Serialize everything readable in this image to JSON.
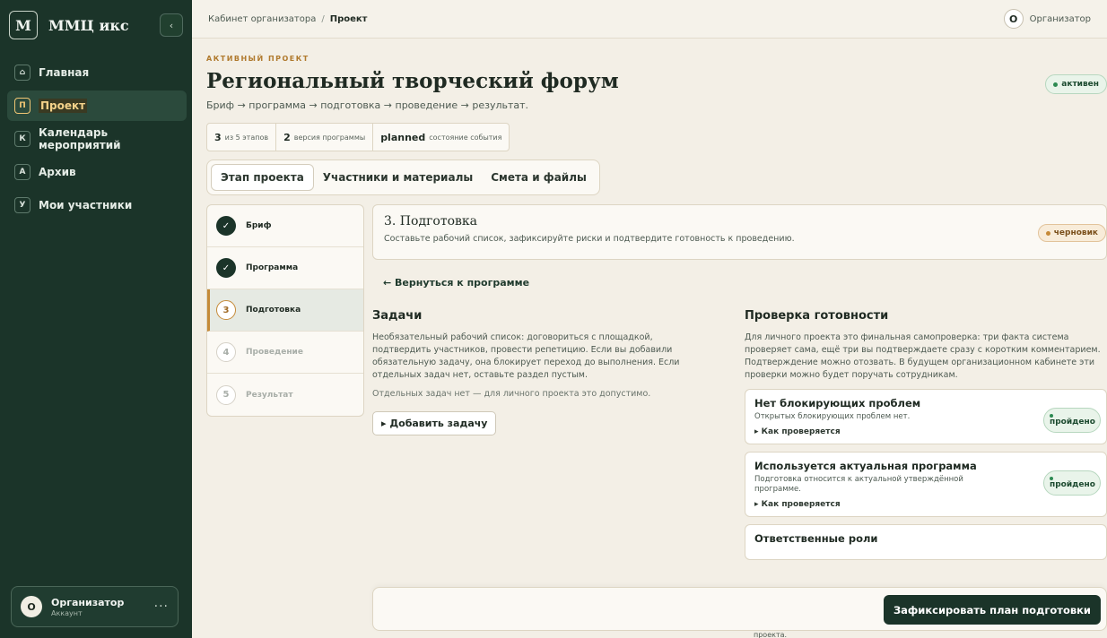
{
  "sidebar": {
    "logo_letter": "М",
    "app_name": "ММЦ икс",
    "collapse_icon": "‹",
    "items": [
      {
        "badge": "⌂",
        "label": "Главная"
      },
      {
        "badge": "П",
        "label": "Проект"
      },
      {
        "badge": "К",
        "label": "Календарь мероприятий"
      },
      {
        "badge": "А",
        "label": "Архив"
      },
      {
        "badge": "У",
        "label": "Мои участники"
      }
    ],
    "account": {
      "initial": "О",
      "name": "Организатор",
      "role": "Аккаунт",
      "more": "···"
    }
  },
  "topbar": {
    "crumb_root": "Кабинет организатора",
    "crumb_sep": "/",
    "crumb_current": "Проект",
    "user_initial": "О",
    "user_name": "Организатор"
  },
  "project": {
    "eyebrow": "АКТИВНЫЙ ПРОЕКТ",
    "title": "Региональный творческий форум",
    "subtitle": "Бриф → программа → подготовка → проведение → результат.",
    "status": "активен",
    "stats": [
      {
        "value": "3",
        "label": "из 5 этапов"
      },
      {
        "value": "2",
        "label": "версия программы"
      },
      {
        "value": "planned",
        "label": "состояние события"
      }
    ],
    "tabs": [
      "Этап проекта",
      "Участники и материалы",
      "Смета и файлы"
    ]
  },
  "steps": [
    {
      "marker": "✓",
      "label": "Бриф"
    },
    {
      "marker": "✓",
      "label": "Программа"
    },
    {
      "marker": "3",
      "label": "Подготовка"
    },
    {
      "marker": "4",
      "label": "Проведение"
    },
    {
      "marker": "5",
      "label": "Результат"
    }
  ],
  "stage": {
    "title": "3. Подготовка",
    "desc": "Составьте рабочий список, зафиксируйте риски и подтвердите готовность к проведению.",
    "status": "черновик",
    "back": "← Вернуться к программе"
  },
  "tasks": {
    "title": "Задачи",
    "desc": "Необязательный рабочий список: договориться с площадкой, подтвердить участников, провести репетицию. Если вы добавили обязательную задачу, она блокирует переход до выполнения. Если отдельных задач нет, оставьте раздел пустым.",
    "empty": "Отдельных задач нет — для личного проекта это допустимо.",
    "add_button": "▸ Добавить задачу"
  },
  "readiness": {
    "title": "Проверка готовности",
    "desc": "Для личного проекта это финальная самопроверка: три факта система проверяет сама, ещё три вы подтверждаете сразу с коротким комментарием. Подтверждение можно отозвать. В будущем организационном кабинете эти проверки можно будет поручать сотрудникам.",
    "checks": [
      {
        "title": "Нет блокирующих проблем",
        "desc": "Открытых блокирующих проблем нет.",
        "how": "▸ Как проверяется",
        "status": "пройдено"
      },
      {
        "title": "Используется актуальная программа",
        "desc": "Подготовка относится к актуальной утверждённой программе.",
        "how": "▸ Как проверяется",
        "status": "пройдено"
      },
      {
        "title": "Ответственные роли",
        "desc": "",
        "how": "",
        "status": ""
      }
    ],
    "tail": "проекта."
  },
  "footer": {
    "primary_button": "Зафиксировать план подготовки"
  }
}
